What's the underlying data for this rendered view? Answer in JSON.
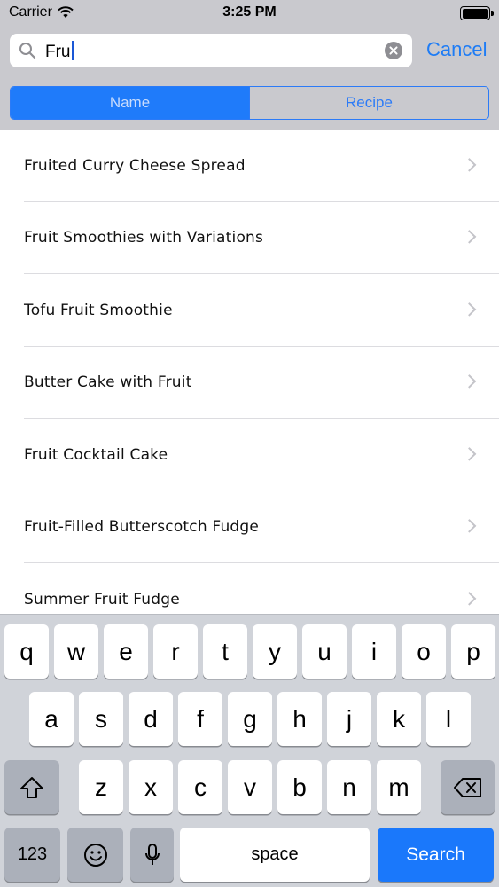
{
  "status_bar": {
    "carrier": "Carrier",
    "time": "3:25 PM"
  },
  "search": {
    "query": "Fru",
    "cancel_label": "Cancel"
  },
  "segments": [
    {
      "label": "Name",
      "selected": true
    },
    {
      "label": "Recipe",
      "selected": false
    }
  ],
  "results": [
    {
      "label": "Fruited Curry Cheese Spread"
    },
    {
      "label": "Fruit Smoothies with Variations"
    },
    {
      "label": "Tofu Fruit Smoothie"
    },
    {
      "label": "Butter Cake with Fruit"
    },
    {
      "label": "Fruit Cocktail Cake"
    },
    {
      "label": "Fruit-Filled Butterscotch Fudge"
    },
    {
      "label": "Summer Fruit Fudge"
    }
  ],
  "keyboard": {
    "row1": [
      "q",
      "w",
      "e",
      "r",
      "t",
      "y",
      "u",
      "i",
      "o",
      "p"
    ],
    "row2": [
      "a",
      "s",
      "d",
      "f",
      "g",
      "h",
      "j",
      "k",
      "l"
    ],
    "row3": [
      "z",
      "x",
      "c",
      "v",
      "b",
      "n",
      "m"
    ],
    "numbers_label": "123",
    "space_label": "space",
    "search_label": "Search"
  },
  "colors": {
    "accent": "#1e7cf5",
    "segment_active": "#1f7bfa",
    "keyboard_bg": "#d0d3d9",
    "search_key": "#1a78fb"
  }
}
